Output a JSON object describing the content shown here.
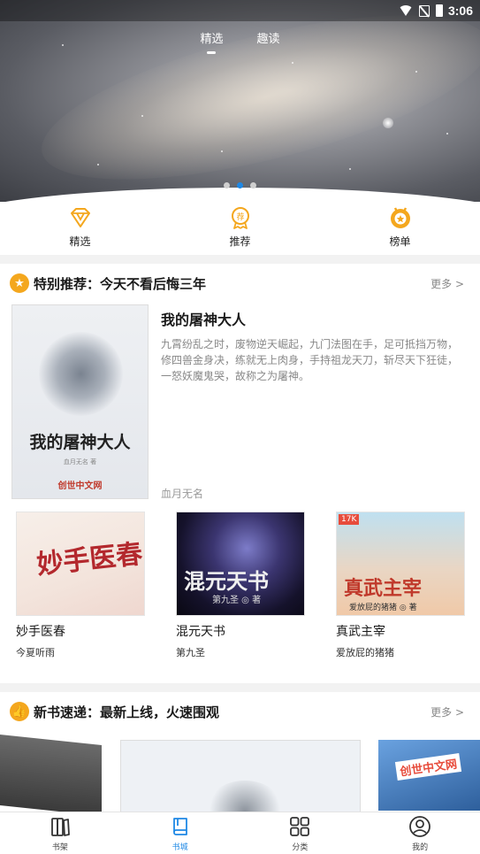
{
  "status_bar": {
    "time": "3:06"
  },
  "top_tabs": [
    {
      "label": "精选",
      "active": true
    },
    {
      "label": "趣读",
      "active": false
    }
  ],
  "banner": {
    "dot_count": 3,
    "active_dot": 1
  },
  "quick_nav": [
    {
      "label": "精选",
      "icon": "diamond-icon"
    },
    {
      "label": "推荐",
      "icon": "recommend-badge-icon"
    },
    {
      "label": "榜单",
      "icon": "ranking-medal-icon"
    }
  ],
  "special": {
    "title": "特别推荐：今天不看后悔三年",
    "more": "更多 >",
    "featured": {
      "title": "我的屠神大人",
      "description": "九霄纷乱之时，废物逆天崛起，九门法图在手，足可抵挡万物，修四兽金身决，练就无上肉身，手持祖龙天刀，斩尽天下狂徒，一怒妖魔鬼哭，故称之为屠神。",
      "author": "血月无名",
      "cover_title": "我的屠神大人",
      "cover_author": "血月无名 著",
      "cover_publisher": "创世中文网"
    },
    "books": [
      {
        "title": "妙手医春",
        "author": "今夏听雨",
        "cover_text": "妙手医春"
      },
      {
        "title": "混元天书",
        "author": "第九圣",
        "cover_text": "混元天书",
        "cover_sub": "第九圣 ◎ 著"
      },
      {
        "title": "真武主宰",
        "author": "爱放屁的猪猪",
        "cover_text": "真武主宰",
        "cover_tag": "17K",
        "cover_sub": "爱放屁的猪猪 ◎ 著"
      }
    ]
  },
  "new_books": {
    "title": "新书速递：最新上线，火速围观",
    "more": "更多 >",
    "cover_right_text": "创世中文网"
  },
  "tab_bar": [
    {
      "label": "书架",
      "icon": "bookshelf-icon",
      "active": false
    },
    {
      "label": "书城",
      "icon": "book-icon",
      "active": true
    },
    {
      "label": "分类",
      "icon": "grid-icon",
      "active": false
    },
    {
      "label": "我的",
      "icon": "user-icon",
      "active": false
    }
  ],
  "colors": {
    "accent": "#1e88e5",
    "orange": "#f4a71e"
  }
}
